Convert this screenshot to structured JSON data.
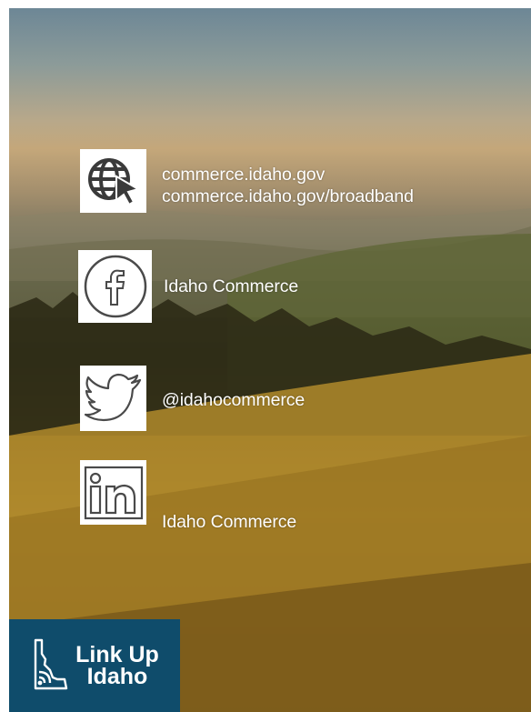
{
  "contacts": {
    "web": {
      "icon": "globe-cursor-icon",
      "line1": "commerce.idaho.gov",
      "line2": "commerce.idaho.gov/broadband"
    },
    "facebook": {
      "icon": "facebook-icon",
      "label": "Idaho Commerce"
    },
    "twitter": {
      "icon": "twitter-icon",
      "label": "@idahocommerce"
    },
    "linkedin": {
      "icon": "linkedin-icon",
      "label": "Idaho Commerce"
    }
  },
  "logo": {
    "icon": "idaho-state-wifi-icon",
    "line1": "Link Up",
    "line2": "Idaho",
    "color": "#0f4c6b"
  }
}
